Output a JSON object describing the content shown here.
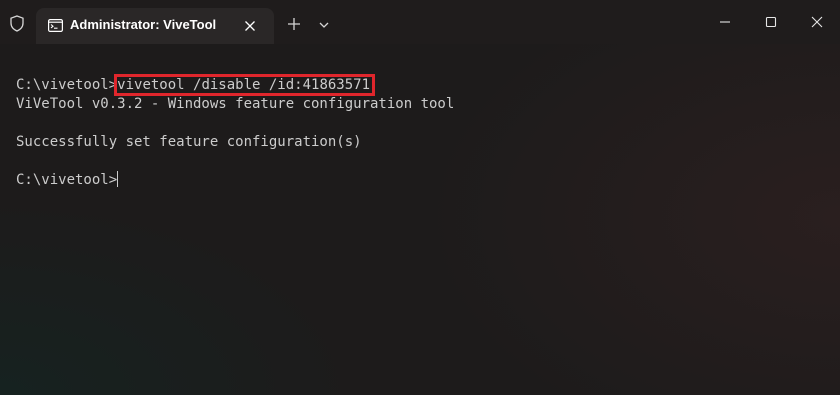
{
  "window": {
    "tab_title": "Administrator: ViveTool"
  },
  "terminal": {
    "prompt_1": "C:\\vivetool>",
    "command": "vivetool /disable /id:41863571",
    "output_1": "ViVeTool v0.3.2 - Windows feature configuration tool",
    "output_2": "Successfully set feature configuration(s)",
    "prompt_2": "C:\\vivetool>"
  },
  "colors": {
    "highlight": "#e0262c",
    "text": "#cccccc",
    "background": "#1d1b1b"
  }
}
